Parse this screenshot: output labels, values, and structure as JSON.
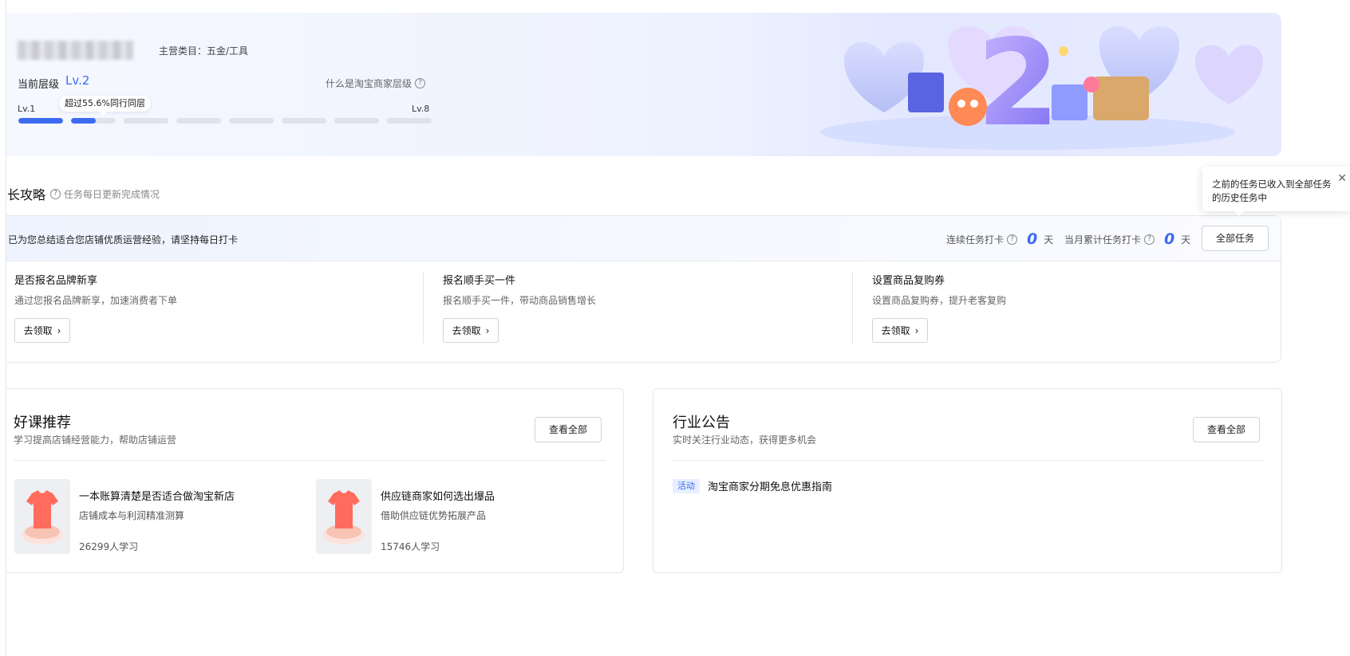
{
  "banner": {
    "category_label": "主营类目：五金/工具",
    "current_level_label": "当前层级",
    "current_level_value": "Lv.2",
    "what_is_level_link": "什么是淘宝商家层级",
    "help_icon_glyph": "?",
    "progress_start_label": "Lv.1",
    "progress_end_label": "Lv.8",
    "progress_bubble": "超过55.6%同行同层",
    "progress_segments": [
      1.0,
      0.55,
      0,
      0,
      0,
      0,
      0,
      0
    ],
    "accent_color": "#3d6cf2",
    "illustration_number": "2",
    "illustration_icon": "level-2-celebration-illustration"
  },
  "strategy": {
    "title": "长攻略",
    "subtitle": "任务每日更新完成情况",
    "help_icon_glyph": "?",
    "tooltip_text": "之前的任务已收入到全部任务的历史任务中",
    "tooltip_close_glyph": "✕",
    "intro_text": "已为您总结适合您店铺优质运营经验，请坚持每日打卡",
    "streak_label": "连续任务打卡",
    "streak_value": "0",
    "streak_unit": "天",
    "monthly_label": "当月累计任务打卡",
    "monthly_value": "0",
    "monthly_unit": "天",
    "all_tasks_button": "全部任务",
    "tasks": [
      {
        "title": "是否报名品牌新享",
        "desc": "通过您报名品牌新享，加速消费者下单",
        "button": "去领取"
      },
      {
        "title": "报名顺手买一件",
        "desc": "报名顺手买一件，带动商品销售增长",
        "button": "去领取"
      },
      {
        "title": "设置商品复购券",
        "desc": "设置商品复购券，提升老客复购",
        "button": "去领取"
      }
    ],
    "chevron_glyph": "›"
  },
  "courses": {
    "title": "好课推荐",
    "subtitle": "学习提高店铺经营能力，帮助店铺运营",
    "view_all_button": "查看全部",
    "items": [
      {
        "title": "一本账算清楚是否适合做淘宝新店",
        "desc": "店铺成本与利润精准测算",
        "learners": "26299人学习"
      },
      {
        "title": "供应链商家如何选出爆品",
        "desc": "借助供应链优势拓展产品",
        "learners": "15746人学习"
      }
    ]
  },
  "notices": {
    "title": "行业公告",
    "subtitle": "实时关注行业动态，获得更多机会",
    "view_all_button": "查看全部",
    "items": [
      {
        "tag": "活动",
        "title": "淘宝商家分期免息优惠指南"
      }
    ]
  }
}
